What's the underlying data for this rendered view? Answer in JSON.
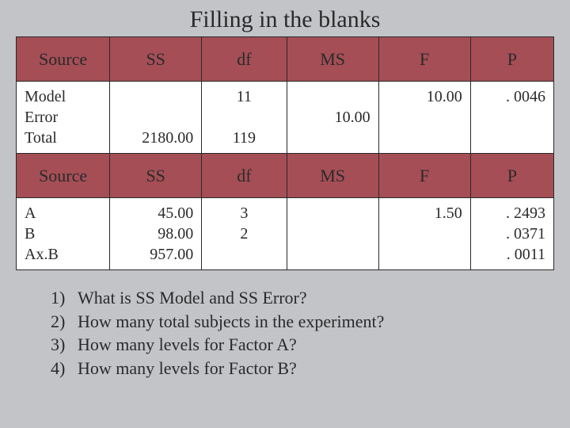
{
  "title": "Filling in the blanks",
  "headers": {
    "source": "Source",
    "ss": "SS",
    "df": "df",
    "ms": "MS",
    "f": "F",
    "p": "P"
  },
  "top": {
    "source_model": "Model",
    "source_error": "Error",
    "source_total": "Total",
    "ss_total": "2180.00",
    "df_model": "11",
    "df_total": "119",
    "ms_error": "10.00",
    "f_model": "10.00",
    "p_model": ". 0046"
  },
  "bottom": {
    "source_a": "A",
    "source_b": "B",
    "source_axb": "Ax.B",
    "ss_a": "45.00",
    "ss_b": "98.00",
    "ss_axb": "957.00",
    "df_a": "3",
    "df_b": "2",
    "f_a": "1.50",
    "p_a": ". 2493",
    "p_b": ". 0371",
    "p_axb": ". 0011"
  },
  "questions": {
    "n1": "1)",
    "q1": "What is SS Model and SS Error?",
    "n2": "2)",
    "q2": "How many total subjects in the experiment?",
    "n3": "3)",
    "q3": "How many levels for Factor A?",
    "n4": "4)",
    "q4": "How many levels for Factor B?"
  },
  "chart_data": [
    {
      "type": "table",
      "title": "ANOVA summary (overall)",
      "columns": [
        "Source",
        "SS",
        "df",
        "MS",
        "F",
        "P"
      ],
      "rows": [
        [
          "Model",
          null,
          11,
          null,
          10.0,
          0.0046
        ],
        [
          "Error",
          null,
          null,
          10.0,
          null,
          null
        ],
        [
          "Total",
          2180.0,
          119,
          null,
          null,
          null
        ]
      ]
    },
    {
      "type": "table",
      "title": "ANOVA summary (effects)",
      "columns": [
        "Source",
        "SS",
        "df",
        "MS",
        "F",
        "P"
      ],
      "rows": [
        [
          "A",
          45.0,
          3,
          null,
          1.5,
          0.2493
        ],
        [
          "B",
          98.0,
          2,
          null,
          null,
          0.0371
        ],
        [
          "Ax.B",
          957.0,
          null,
          null,
          null,
          0.0011
        ]
      ]
    }
  ]
}
